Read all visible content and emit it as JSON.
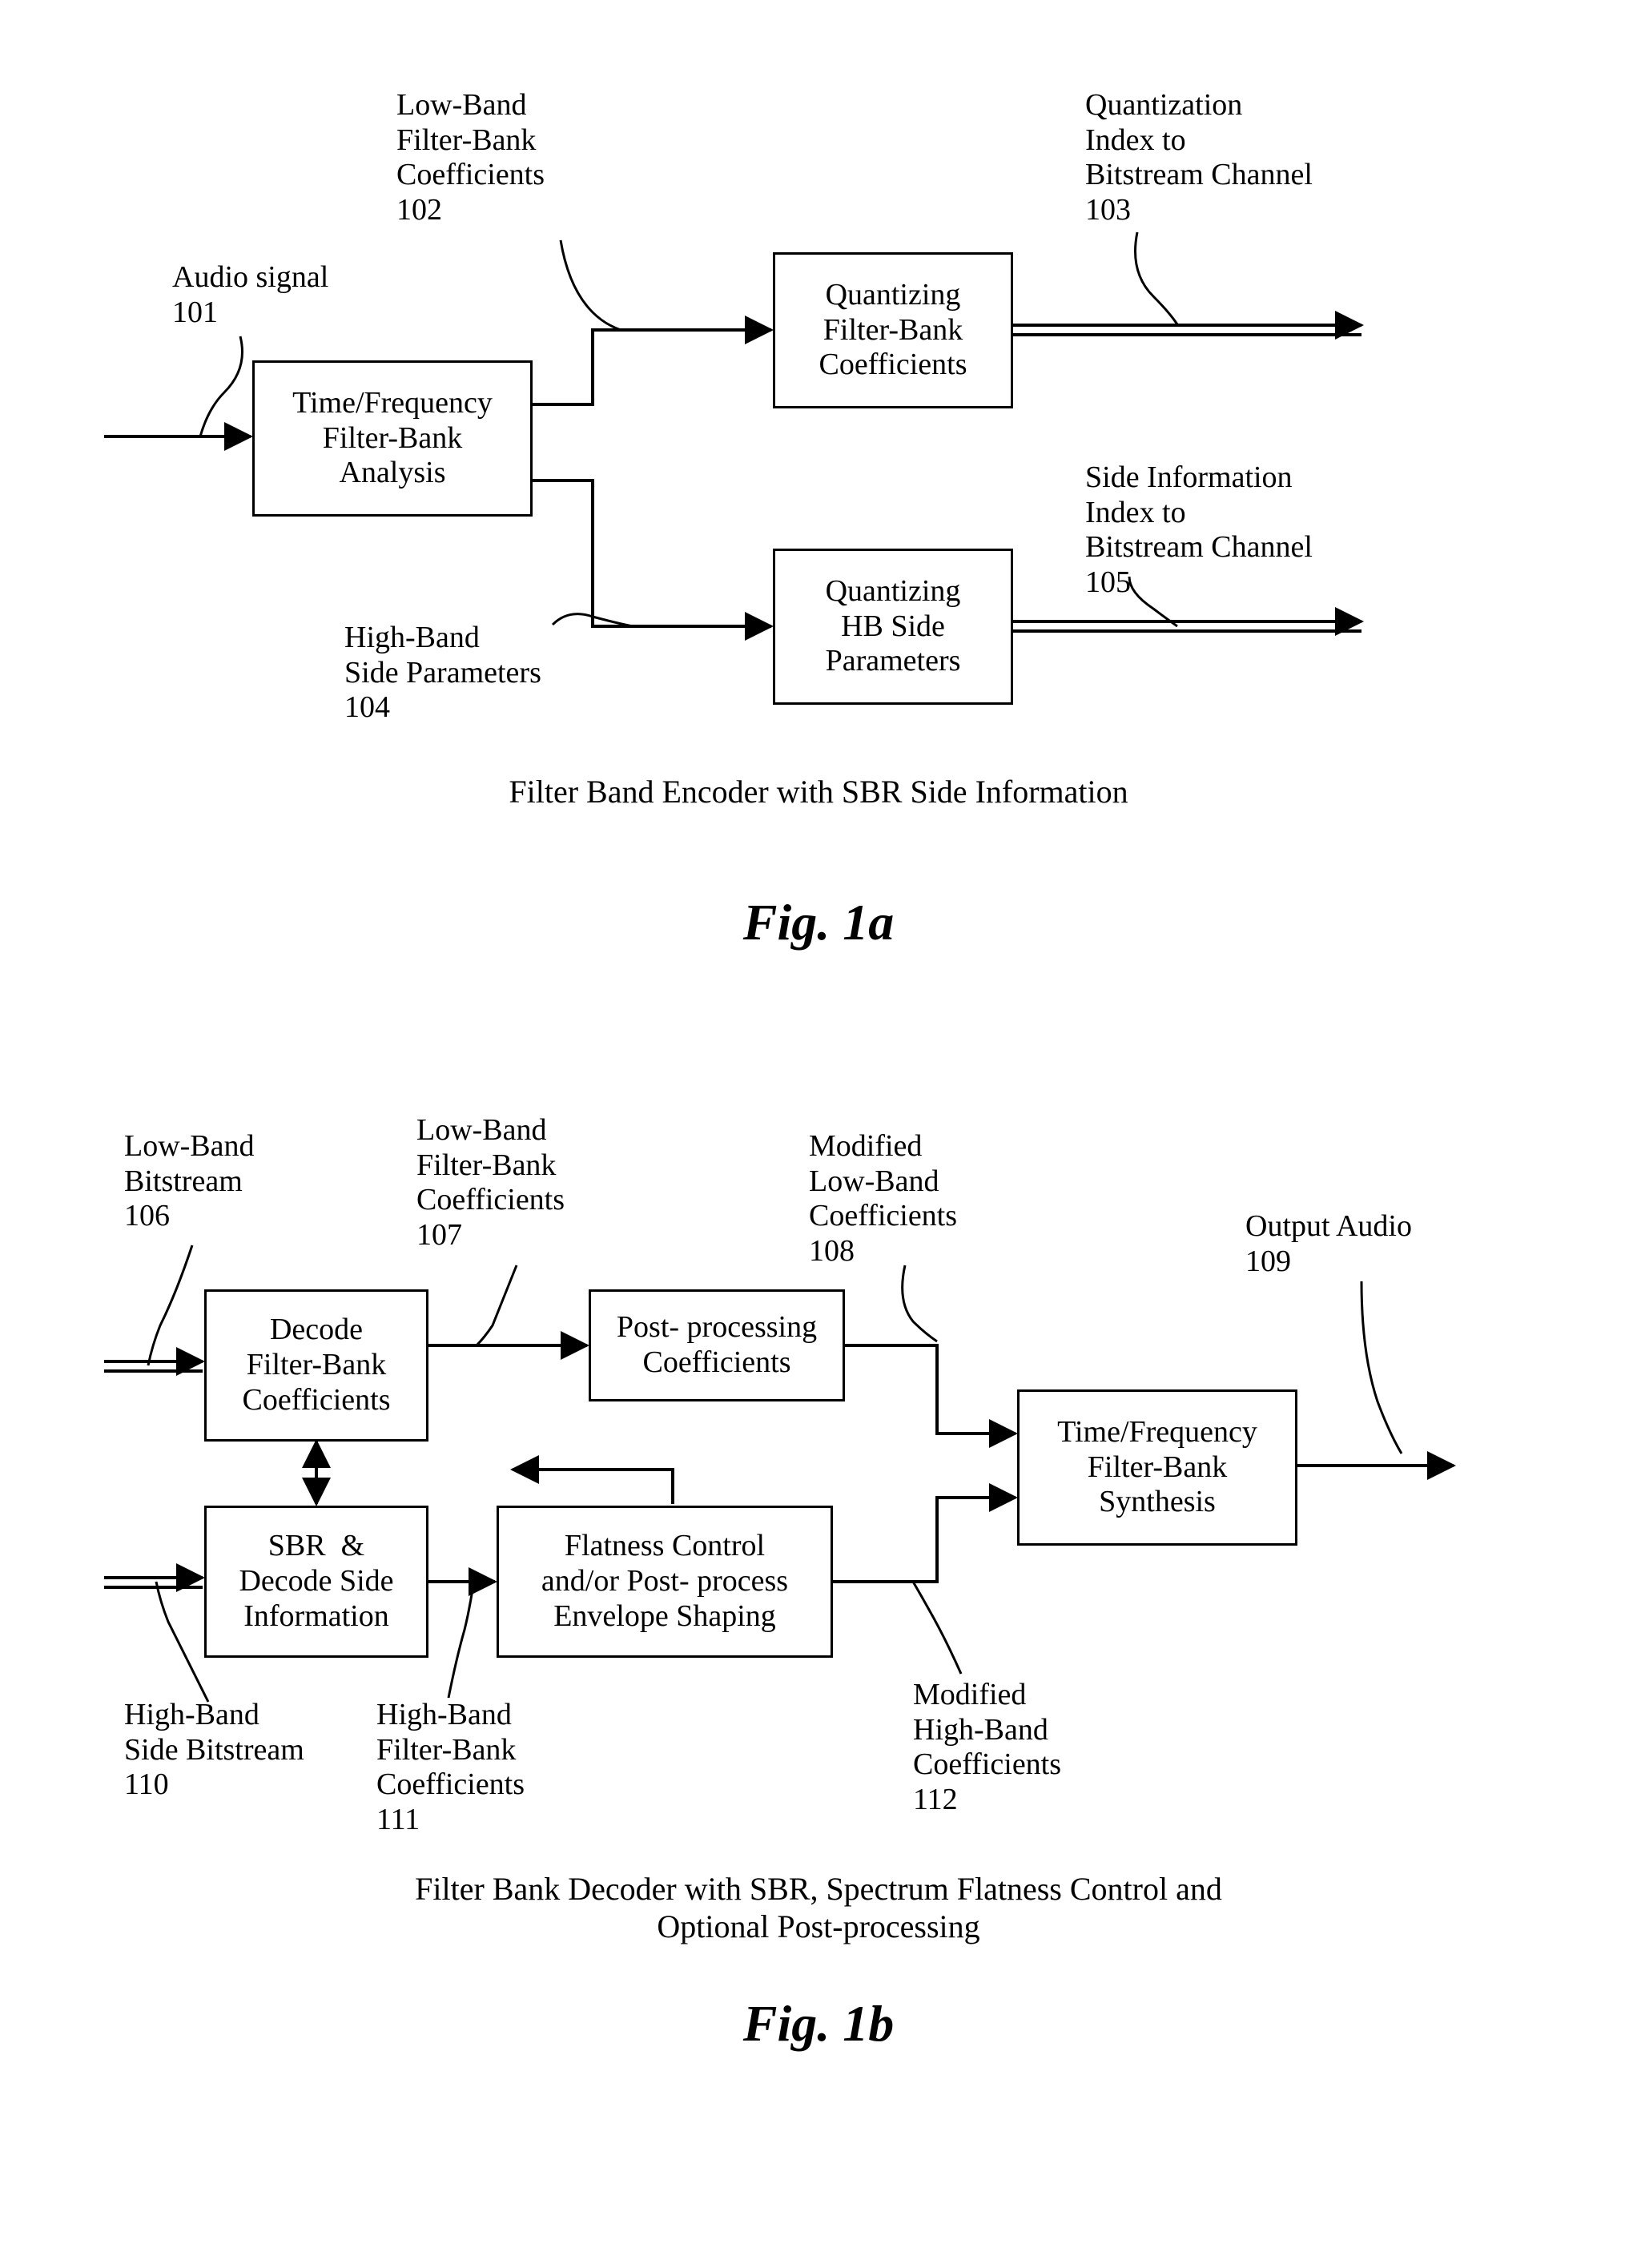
{
  "fig1a": {
    "labels": {
      "audio_signal": "Audio signal\n101",
      "lb_coefs": "Low-Band\nFilter-Bank\nCoefficients\n102",
      "quant_idx": "Quantization\nIndex to\nBitstream Channel\n103",
      "hb_params": "High-Band\nSide Parameters\n104",
      "side_info": "Side Information\nIndex to\nBitstream Channel\n105"
    },
    "blocks": {
      "tf_analysis": "Time/Frequency\nFilter-Bank\nAnalysis",
      "quant_fb": "Quantizing\nFilter-Bank\nCoefficients",
      "quant_hb": "Quantizing\nHB Side\nParameters"
    },
    "caption": "Filter Band Encoder with SBR Side Information",
    "title": "Fig. 1a"
  },
  "fig1b": {
    "labels": {
      "lb_bitstream": "Low-Band\nBitstream\n106",
      "lb_fb_coefs": "Low-Band\nFilter-Bank\nCoefficients\n107",
      "mod_lb_coefs": "Modified\nLow-Band\nCoefficients\n108",
      "out_audio": "Output Audio\n109",
      "hb_side_bs": "High-Band\nSide Bitstream\n110",
      "hb_fb_coefs": "High-Band\nFilter-Bank\nCoefficients\n111",
      "mod_hb_coefs": "Modified\nHigh-Band\nCoefficients\n112"
    },
    "blocks": {
      "decode_fb": "Decode\nFilter-Bank\nCoefficients",
      "post_proc": "Post- processing\nCoefficients",
      "sbr_decode": "SBR  &\nDecode Side\nInformation",
      "flatness": "Flatness Control\nand/or Post- process\nEnvelope Shaping",
      "tf_synth": "Time/Frequency\nFilter-Bank\nSynthesis"
    },
    "caption": "Filter Bank Decoder with SBR, Spectrum Flatness Control and\nOptional Post-processing",
    "title": "Fig. 1b"
  }
}
